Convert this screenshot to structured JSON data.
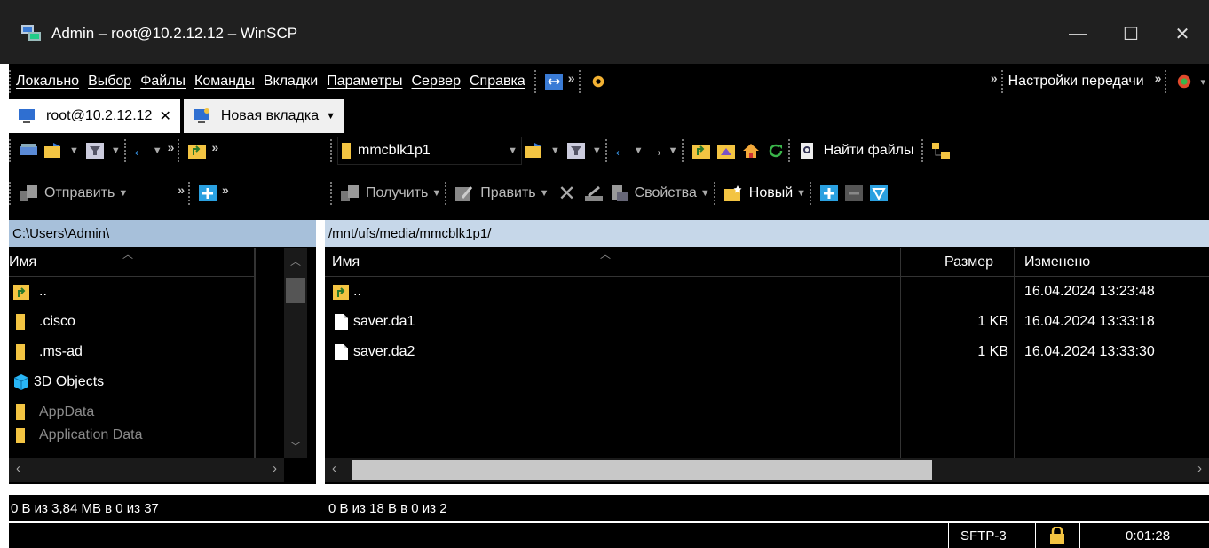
{
  "window": {
    "title": "Admin – root@10.2.12.12 – WinSCP",
    "minimize_glyph": "—",
    "maximize_glyph": "☐",
    "close_glyph": "✕"
  },
  "menu": {
    "items": [
      "Локально",
      "Выбор",
      "Файлы",
      "Команды",
      "Вкладки",
      "Параметры",
      "Сервер",
      "Справка"
    ],
    "transfer_settings": "Настройки передачи"
  },
  "tabs": {
    "session": "root@10.2.12.12",
    "session_close": "✕",
    "new_tab": "Новая вкладка"
  },
  "toolbar": {
    "remote_dir": "mmcblk1p1",
    "find_files": "Найти файлы",
    "send": "Отправить",
    "receive": "Получить",
    "edit": "Править",
    "properties": "Свойства",
    "new": "Новый"
  },
  "local": {
    "path": "C:\\Users\\Admin\\",
    "col_name": "Имя",
    "files": [
      {
        "name": "..",
        "icon": "parent-folder-icon",
        "dim": false
      },
      {
        "name": ".cisco",
        "icon": "folder-icon",
        "dim": false
      },
      {
        "name": ".ms-ad",
        "icon": "folder-icon",
        "dim": false
      },
      {
        "name": "3D Objects",
        "icon": "3d-objects-icon",
        "dim": false
      },
      {
        "name": "AppData",
        "icon": "folder-icon",
        "dim": true
      },
      {
        "name": "Application Data",
        "icon": "folder-icon",
        "dim": true
      }
    ],
    "status": "0 B из 3,84 MB в 0 из 37"
  },
  "remote": {
    "path": "/mnt/ufs/media/mmcblk1p1/",
    "col_name": "Имя",
    "col_size": "Размер",
    "col_modified": "Изменено",
    "files": [
      {
        "name": "..",
        "icon": "parent-folder-icon",
        "size": "",
        "modified": "16.04.2024 13:23:48"
      },
      {
        "name": "saver.da1",
        "icon": "file-icon",
        "size": "1 KB",
        "modified": "16.04.2024 13:33:18"
      },
      {
        "name": "saver.da2",
        "icon": "file-icon",
        "size": "1 KB",
        "modified": "16.04.2024 13:33:30"
      }
    ],
    "status": "0 B из 18 B в 0 из 2"
  },
  "statusbar": {
    "protocol": "SFTP-3",
    "elapsed": "0:01:28"
  },
  "colors": {
    "path_bar_active": "#c6d7e9",
    "path_bar_inactive": "#a7c0da",
    "folder": "#f3c442",
    "chrome_dark": "#202020"
  }
}
